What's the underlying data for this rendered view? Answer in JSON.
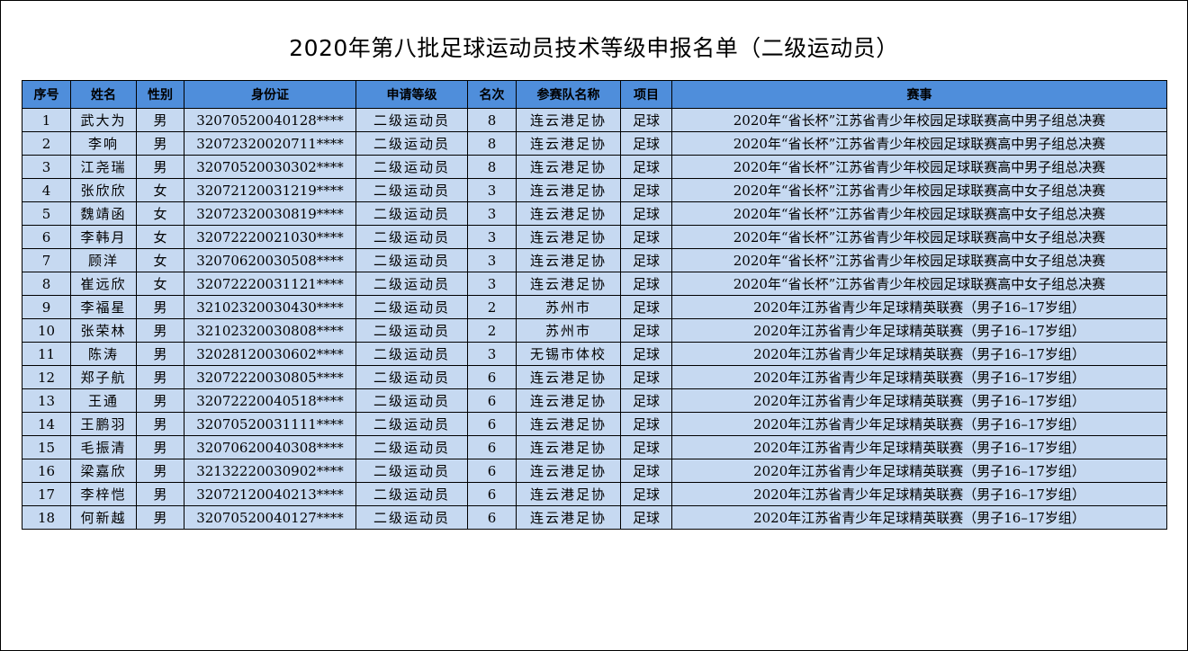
{
  "title": "2020年第八批足球运动员技术等级申报名单（二级运动员）",
  "colors": {
    "header_bg": "#4f8edb",
    "row_bg": "#c6d9f1"
  },
  "columns": [
    "序号",
    "姓名",
    "性别",
    "身份证",
    "申请等级",
    "名次",
    "参赛队名称",
    "项目",
    "赛事"
  ],
  "rows": [
    [
      "1",
      "武大为",
      "男",
      "32070520040128****",
      "二级运动员",
      "8",
      "连云港足协",
      "足球",
      "2020年“省长杯”江苏省青少年校园足球联赛高中男子组总决赛"
    ],
    [
      "2",
      "李响",
      "男",
      "32072320020711****",
      "二级运动员",
      "8",
      "连云港足协",
      "足球",
      "2020年“省长杯”江苏省青少年校园足球联赛高中男子组总决赛"
    ],
    [
      "3",
      "江尧瑞",
      "男",
      "32070520030302****",
      "二级运动员",
      "8",
      "连云港足协",
      "足球",
      "2020年“省长杯”江苏省青少年校园足球联赛高中男子组总决赛"
    ],
    [
      "4",
      "张欣欣",
      "女",
      "32072120031219****",
      "二级运动员",
      "3",
      "连云港足协",
      "足球",
      "2020年“省长杯”江苏省青少年校园足球联赛高中女子组总决赛"
    ],
    [
      "5",
      "魏靖函",
      "女",
      "32072320030819****",
      "二级运动员",
      "3",
      "连云港足协",
      "足球",
      "2020年“省长杯”江苏省青少年校园足球联赛高中女子组总决赛"
    ],
    [
      "6",
      "李韩月",
      "女",
      "32072220021030****",
      "二级运动员",
      "3",
      "连云港足协",
      "足球",
      "2020年“省长杯”江苏省青少年校园足球联赛高中女子组总决赛"
    ],
    [
      "7",
      "顾洋",
      "女",
      "32070620030508****",
      "二级运动员",
      "3",
      "连云港足协",
      "足球",
      "2020年“省长杯”江苏省青少年校园足球联赛高中女子组总决赛"
    ],
    [
      "8",
      "崔远欣",
      "女",
      "32072220031121****",
      "二级运动员",
      "3",
      "连云港足协",
      "足球",
      "2020年“省长杯”江苏省青少年校园足球联赛高中女子组总决赛"
    ],
    [
      "9",
      "李福星",
      "男",
      "32102320030430****",
      "二级运动员",
      "2",
      "苏州市",
      "足球",
      "2020年江苏省青少年足球精英联赛（男子16–17岁组）"
    ],
    [
      "10",
      "张荣林",
      "男",
      "32102320030808****",
      "二级运动员",
      "2",
      "苏州市",
      "足球",
      "2020年江苏省青少年足球精英联赛（男子16–17岁组）"
    ],
    [
      "11",
      "陈涛",
      "男",
      "32028120030602****",
      "二级运动员",
      "3",
      "无锡市体校",
      "足球",
      "2020年江苏省青少年足球精英联赛（男子16–17岁组）"
    ],
    [
      "12",
      "郑子航",
      "男",
      "32072220030805****",
      "二级运动员",
      "6",
      "连云港足协",
      "足球",
      "2020年江苏省青少年足球精英联赛（男子16–17岁组）"
    ],
    [
      "13",
      "王通",
      "男",
      "32072220040518****",
      "二级运动员",
      "6",
      "连云港足协",
      "足球",
      "2020年江苏省青少年足球精英联赛（男子16–17岁组）"
    ],
    [
      "14",
      "王鹏羽",
      "男",
      "32070520031111****",
      "二级运动员",
      "6",
      "连云港足协",
      "足球",
      "2020年江苏省青少年足球精英联赛（男子16–17岁组）"
    ],
    [
      "15",
      "毛振清",
      "男",
      "32070620040308****",
      "二级运动员",
      "6",
      "连云港足协",
      "足球",
      "2020年江苏省青少年足球精英联赛（男子16–17岁组）"
    ],
    [
      "16",
      "梁嘉欣",
      "男",
      "32132220030902****",
      "二级运动员",
      "6",
      "连云港足协",
      "足球",
      "2020年江苏省青少年足球精英联赛（男子16–17岁组）"
    ],
    [
      "17",
      "李梓恺",
      "男",
      "32072120040213****",
      "二级运动员",
      "6",
      "连云港足协",
      "足球",
      "2020年江苏省青少年足球精英联赛（男子16–17岁组）"
    ],
    [
      "18",
      "何新越",
      "男",
      "32070520040127****",
      "二级运动员",
      "6",
      "连云港足协",
      "足球",
      "2020年江苏省青少年足球精英联赛（男子16–17岁组）"
    ]
  ]
}
